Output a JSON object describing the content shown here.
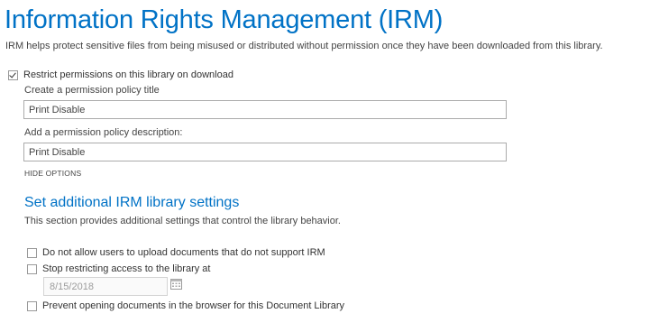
{
  "header": {
    "title": "Information Rights Management (IRM)",
    "description": "IRM helps protect sensitive files from being misused or distributed without permission once they have been downloaded from this library."
  },
  "restrict": {
    "label": "Restrict permissions on this library on download",
    "checked": true
  },
  "policy_title": {
    "label": "Create a permission policy title",
    "value": "Print Disable"
  },
  "policy_description": {
    "label": "Add a permission policy description:",
    "value": "Print Disable"
  },
  "hide_options_label": "HIDE OPTIONS",
  "additional_settings": {
    "title": "Set additional IRM library settings",
    "description": "This section provides additional settings that control the library behavior.",
    "options": [
      {
        "label": "Do not allow users to upload documents that do not support IRM",
        "checked": false
      },
      {
        "label": "Stop restricting access to the library at",
        "checked": false
      },
      {
        "label": "Prevent opening documents in the browser for this Document Library",
        "checked": false
      }
    ],
    "date_value": "8/15/2018"
  },
  "icons": {
    "calendar": "calendar-icon",
    "checkbox_checked": "checkmark-icon"
  },
  "colors": {
    "heading": "#0072c6",
    "text": "#444444",
    "input_border": "#ababab"
  }
}
